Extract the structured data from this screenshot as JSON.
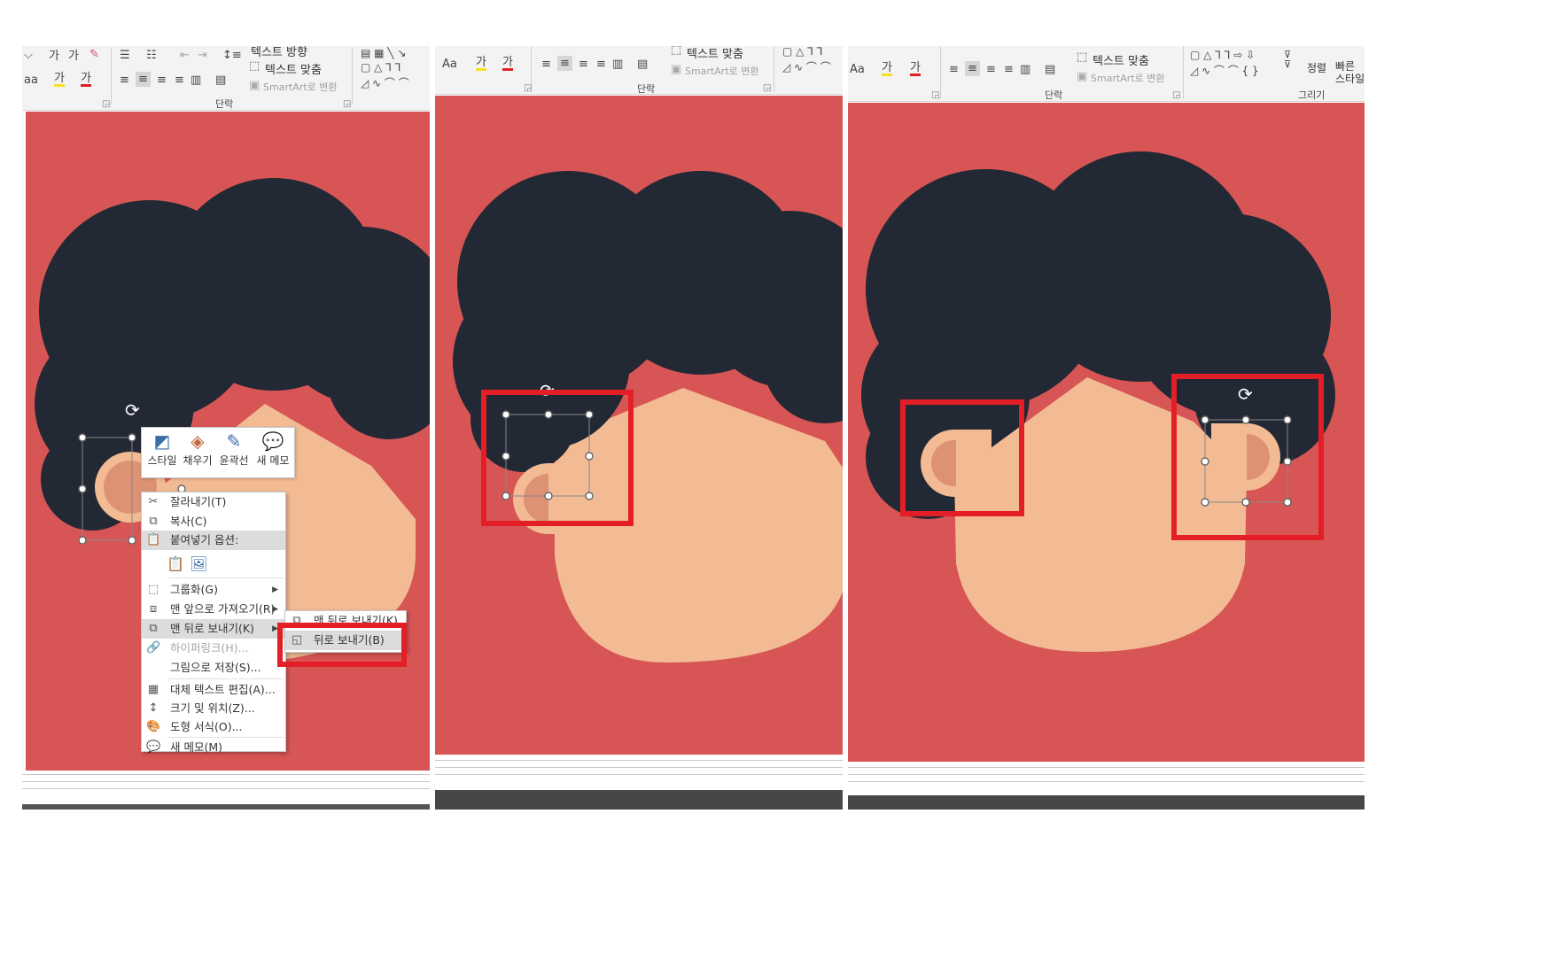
{
  "panels": [
    {
      "id": "left",
      "ribbon": {
        "text_direction": "텍스트 방향",
        "text_align": "텍스트 맞춤",
        "smartart": "SmartArt로 변환",
        "group_label": "단락",
        "font_glyphs": [
          "가",
          "가",
          "가"
        ],
        "font_size_partial": "aa"
      },
      "mini_toolbar": {
        "buttons": [
          {
            "label": "스타일",
            "icon": "shape-style-icon"
          },
          {
            "label": "채우기",
            "icon": "paint-bucket-icon"
          },
          {
            "label": "윤곽선",
            "icon": "pen-outline-icon"
          },
          {
            "label": "새 메모",
            "icon": "new-comment-icon"
          }
        ]
      },
      "context_menu": {
        "items": [
          {
            "label": "잘라내기(T)",
            "icon": "scissors-icon"
          },
          {
            "label": "복사(C)",
            "icon": "copy-icon"
          },
          {
            "label": "붙여넣기 옵션:",
            "icon": "paste-icon"
          },
          {
            "label": "그룹화(G)",
            "icon": "group-icon",
            "submenu": true
          },
          {
            "label": "맨 앞으로 가져오기(R)",
            "icon": "bring-front-icon",
            "submenu": true
          },
          {
            "label": "맨 뒤로 보내기(K)",
            "icon": "send-back-icon",
            "submenu": true,
            "highlighted": true
          },
          {
            "label": "하이퍼링크(H)...",
            "icon": "hyperlink-icon",
            "disabled": true
          },
          {
            "label": "그림으로 저장(S)...",
            "icon": ""
          },
          {
            "label": "대체 텍스트 편집(A)...",
            "icon": "alt-text-icon"
          },
          {
            "label": "크기 및 위치(Z)...",
            "icon": "size-position-icon"
          },
          {
            "label": "도형 서식(O)...",
            "icon": "format-shape-icon"
          },
          {
            "label": "새 메모(M)",
            "icon": "comment-icon"
          }
        ],
        "submenu_items": [
          {
            "label": "맨 뒤로 보내기(K)"
          },
          {
            "label": "뒤로 보내기(B)",
            "highlighted": true
          }
        ]
      }
    },
    {
      "id": "middle",
      "ribbon": {
        "text_align": "텍스트 맞춤",
        "smartart": "SmartArt로 변환",
        "group_label": "단락",
        "font_size_partial": "Aa",
        "font_glyphs": [
          "가",
          "가"
        ]
      }
    },
    {
      "id": "right",
      "ribbon": {
        "text_align": "텍스트 맞춤",
        "smartart": "SmartArt로 변환",
        "group_label_paragraph": "단락",
        "group_label_drawing": "그리기",
        "arrange": "정렬",
        "quick_styles": "빠른\n스타일",
        "font_size_partial": "Aa",
        "font_glyphs": [
          "가",
          "가"
        ]
      }
    }
  ],
  "colors": {
    "slide_bg": "#d75555",
    "hair": "#222834",
    "skin": "#f2bb94",
    "ear_inner": "#dd9274",
    "highlight_box": "#e41e26"
  }
}
